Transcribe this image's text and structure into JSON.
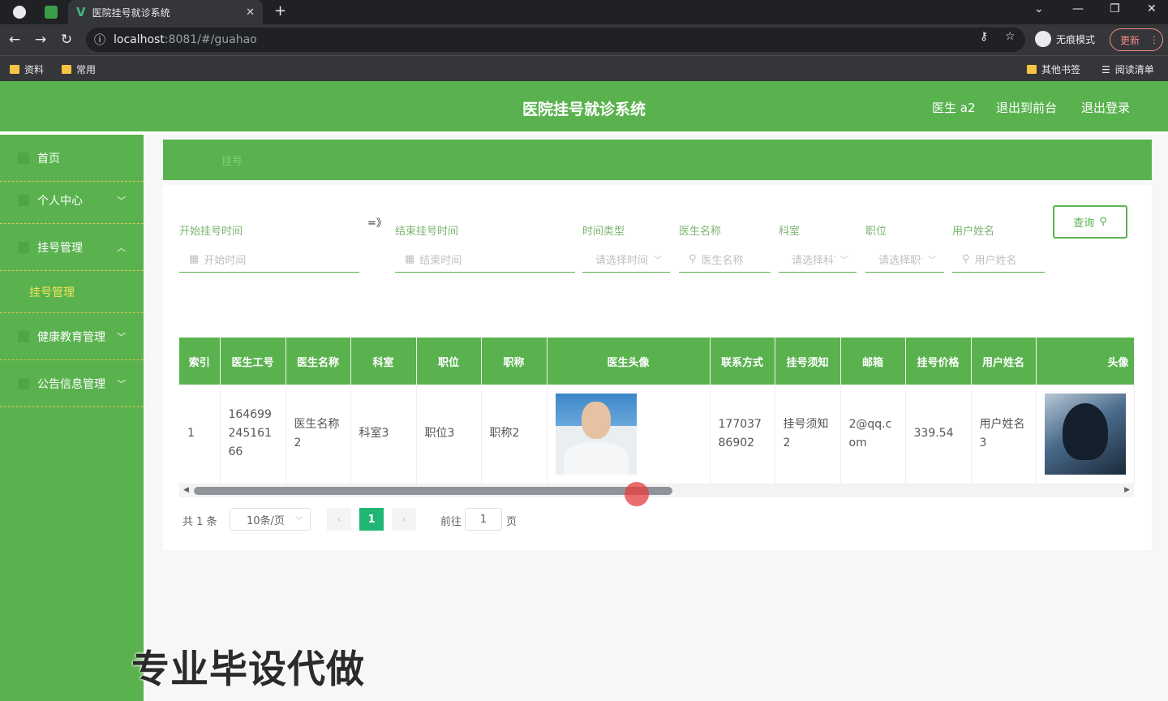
{
  "browser": {
    "tab_title": "医院挂号就诊系统",
    "tab_icon": "vue-logo-icon",
    "new_tab_symbol": "+",
    "close_symbol": "✕",
    "url_host": "localhost",
    "url_rest": ":8081/#/guahao",
    "incognito_label": "无痕模式",
    "update_label": "更新",
    "bookmarks": [
      "资料",
      "常用"
    ],
    "bookmarks_right": [
      "其他书签",
      "阅读清单"
    ]
  },
  "header": {
    "title": "医院挂号就诊系统",
    "user": "医生 a2",
    "to_front": "退出到前台",
    "logout": "退出登录"
  },
  "sidebar": {
    "items": [
      {
        "label": "首页"
      },
      {
        "label": "个人中心"
      },
      {
        "label": "挂号管理"
      },
      {
        "label": "健康教育管理"
      },
      {
        "label": "公告信息管理"
      }
    ],
    "sub_item": "挂号管理"
  },
  "breadcrumb": "挂号",
  "filters": {
    "start_label": "开始挂号时间",
    "start_placeholder": "开始时间",
    "arrow": "=》",
    "end_label": "结束挂号时间",
    "end_placeholder": "结束时间",
    "time_type_label": "时间类型",
    "time_type_placeholder": "请选择时间",
    "doctor_label": "医生名称",
    "doctor_placeholder": "医生名称",
    "dept_label": "科室",
    "dept_placeholder": "请选择科室",
    "position_label": "职位",
    "position_placeholder": "请选择职位",
    "user_label": "用户姓名",
    "user_placeholder": "用户姓名",
    "query_button": "查询"
  },
  "table": {
    "headers": [
      "索引",
      "医生工号",
      "医生名称",
      "科室",
      "职位",
      "职称",
      "医生头像",
      "联系方式",
      "挂号须知",
      "邮箱",
      "挂号价格",
      "用户姓名",
      "头像"
    ],
    "rows": [
      {
        "index": "1",
        "doctor_id": "16469924516166",
        "doctor_name": "医生名称2",
        "dept": "科室3",
        "position": "职位3",
        "title": "职称2",
        "phone": "17703786902",
        "notice": "挂号须知2",
        "email": "2@qq.com",
        "price": "339.54",
        "user_name": "用户姓名3"
      }
    ]
  },
  "pagination": {
    "total": "共 1 条",
    "page_size": "10条/页",
    "current_page": "1",
    "goto_label": "前往",
    "goto_value": "1",
    "page_suffix": "页"
  },
  "overlay_text": "专业毕设代做"
}
